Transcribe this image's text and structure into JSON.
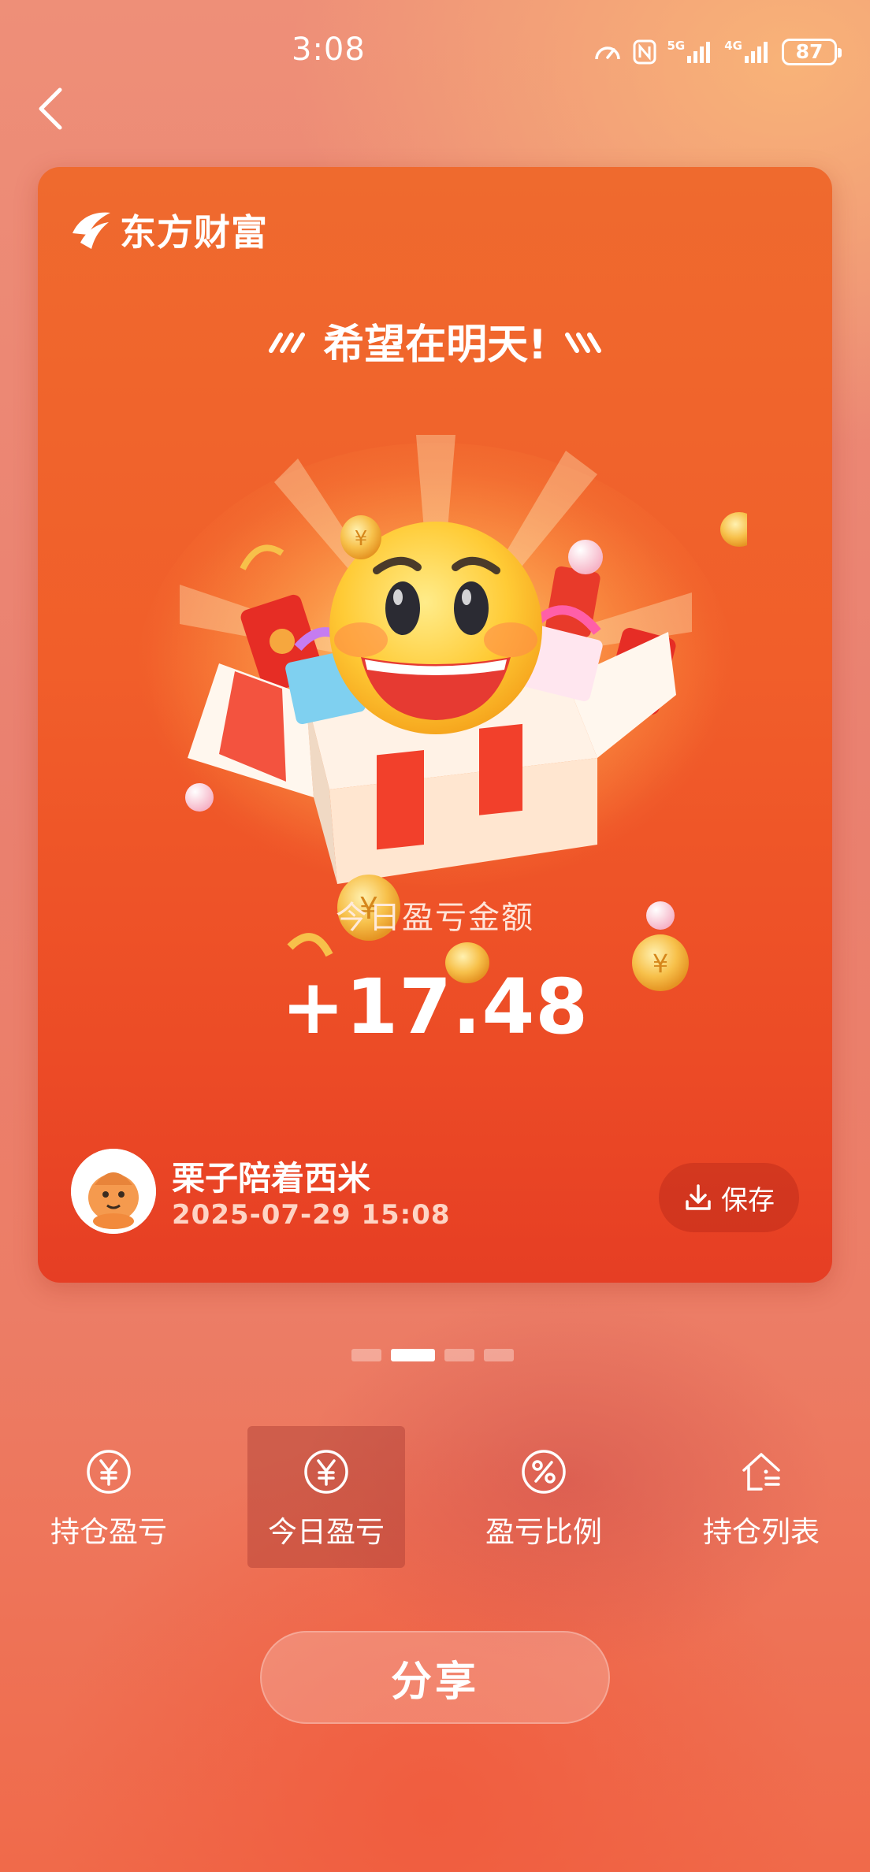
{
  "status_bar": {
    "time": "3:08",
    "network_1": "5G",
    "network_2": "4G",
    "battery": "87"
  },
  "card": {
    "brand_name": "东方财富",
    "motto": "希望在明天!",
    "pnl_label": "今日盈亏金额",
    "pnl_value": "+17.48",
    "user_name": "栗子陪着西米",
    "timestamp": "2025-07-29 15:08",
    "save_label": "保存"
  },
  "pager": {
    "total": 4,
    "active_index": 1
  },
  "tabs": [
    {
      "label": "持仓盈亏",
      "icon": "yen-circle-icon"
    },
    {
      "label": "今日盈亏",
      "icon": "yen-circle-icon",
      "active": true
    },
    {
      "label": "盈亏比例",
      "icon": "percent-circle-icon"
    },
    {
      "label": "持仓列表",
      "icon": "house-list-icon"
    }
  ],
  "share_label": "分享",
  "colors": {
    "card_top": "#ef6a2e",
    "card_bottom": "#e63e24",
    "emoji_face": "#ffcf3a",
    "active_tab": "#b44a3c"
  }
}
